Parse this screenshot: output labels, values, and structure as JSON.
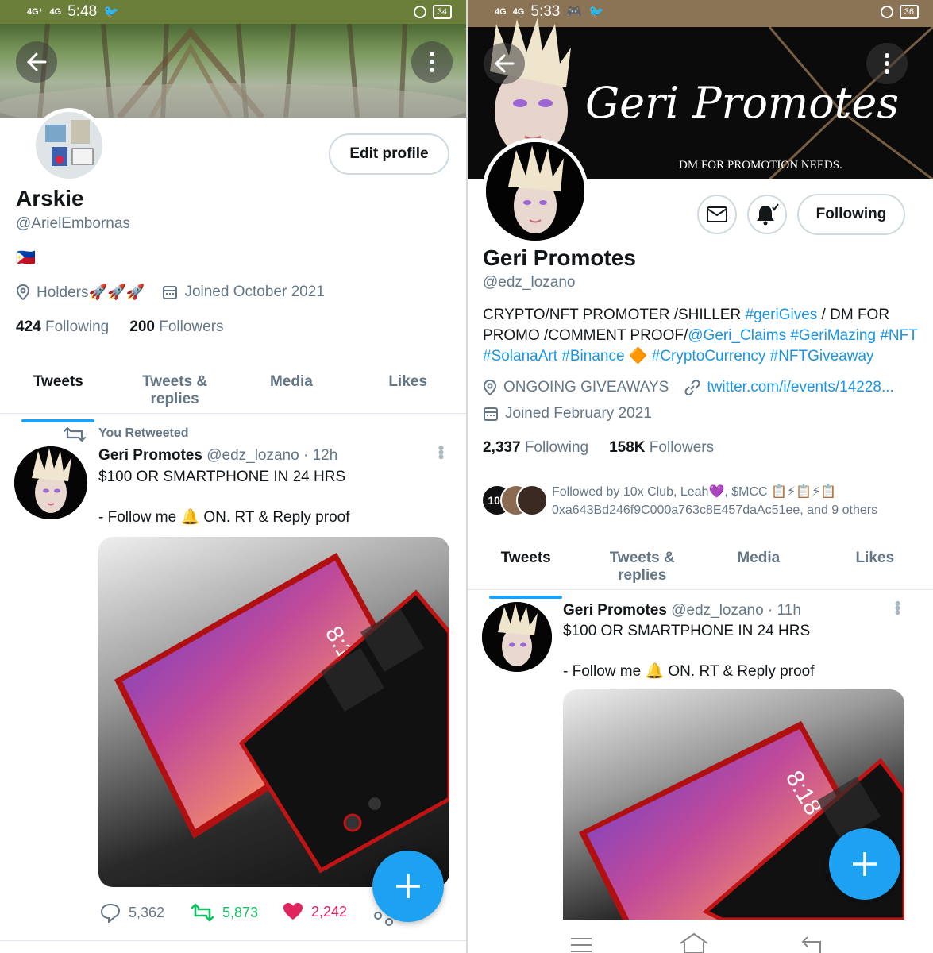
{
  "left": {
    "status": {
      "signal1": "4G⁺",
      "signal2": "4G",
      "time": "5:48",
      "battery": "34"
    },
    "profile": {
      "name": "Arskie",
      "handle": "@ArielEmbornas",
      "flag": "🇵🇭",
      "location": "Holders🚀🚀🚀",
      "joined": "Joined October 2021",
      "following_count": "424",
      "following_label": "Following",
      "followers_count": "200",
      "followers_label": "Followers",
      "edit_label": "Edit profile"
    },
    "tabs": [
      "Tweets",
      "Tweets & replies",
      "Media",
      "Likes"
    ],
    "tweet": {
      "retweet_label": "You Retweeted",
      "author": "Geri Promotes",
      "handle": "@edz_lozano",
      "time": "· 12h",
      "line1": "$100 OR SMARTPHONE IN 24 HRS",
      "line2": "- Follow me 🔔 ON. RT & Reply proof",
      "phone_time": "8:18",
      "replies": "5,362",
      "retweets": "5,873",
      "likes": "2,242"
    }
  },
  "right": {
    "status": {
      "signal1": "4G",
      "signal2": "4G",
      "time": "5:33",
      "battery": "36"
    },
    "banner": {
      "script_title": "Geri Promotes",
      "subtitle": "DM FOR PROMOTION NEEDS."
    },
    "profile": {
      "name": "Geri Promotes",
      "handle": "@edz_lozano",
      "bio_1a": "CRYPTO/NFT PROMOTER /SHILLER ",
      "bio_1b": "#geriGives",
      "bio_1c": " / DM FOR",
      "bio_2a": "PROMO /COMMENT PROOF/",
      "bio_2b": "@Geri_Claims #GeriMazing #NFT",
      "bio_3a": "#SolanaArt #Binance",
      "bio_3b": "🔶",
      "bio_3c": " #CryptoCurrency #NFTGiveaway",
      "location": "ONGOING GIVEAWAYS",
      "link": "twitter.com/i/events/14228...",
      "joined": "Joined February 2021",
      "following_count": "2,337",
      "following_label": "Following",
      "followers_count": "158K",
      "followers_label": "Followers",
      "following_button": "Following",
      "followed_by_1": "Followed by 10x Club, Leah💜, $MCC 📋⚡📋⚡📋",
      "followed_by_2": "0xa643Bd246f9C000a763c8E457daAc51ee, and 9 others",
      "avatar_badge": "10x"
    },
    "tabs": [
      "Tweets",
      "Tweets & replies",
      "Media",
      "Likes"
    ],
    "tweet": {
      "author": "Geri Promotes",
      "handle": "@edz_lozano",
      "time": "· 11h",
      "line1": "$100 OR SMARTPHONE IN 24 HRS",
      "line2": "- Follow me 🔔 ON. RT & Reply proof",
      "phone_time": "8:18"
    }
  },
  "colors": {
    "accent": "#1da1f2",
    "like": "#e0245e",
    "retweet": "#17bf63",
    "statusbar_left": "#6b7f3a",
    "statusbar_right": "#8b7355"
  }
}
